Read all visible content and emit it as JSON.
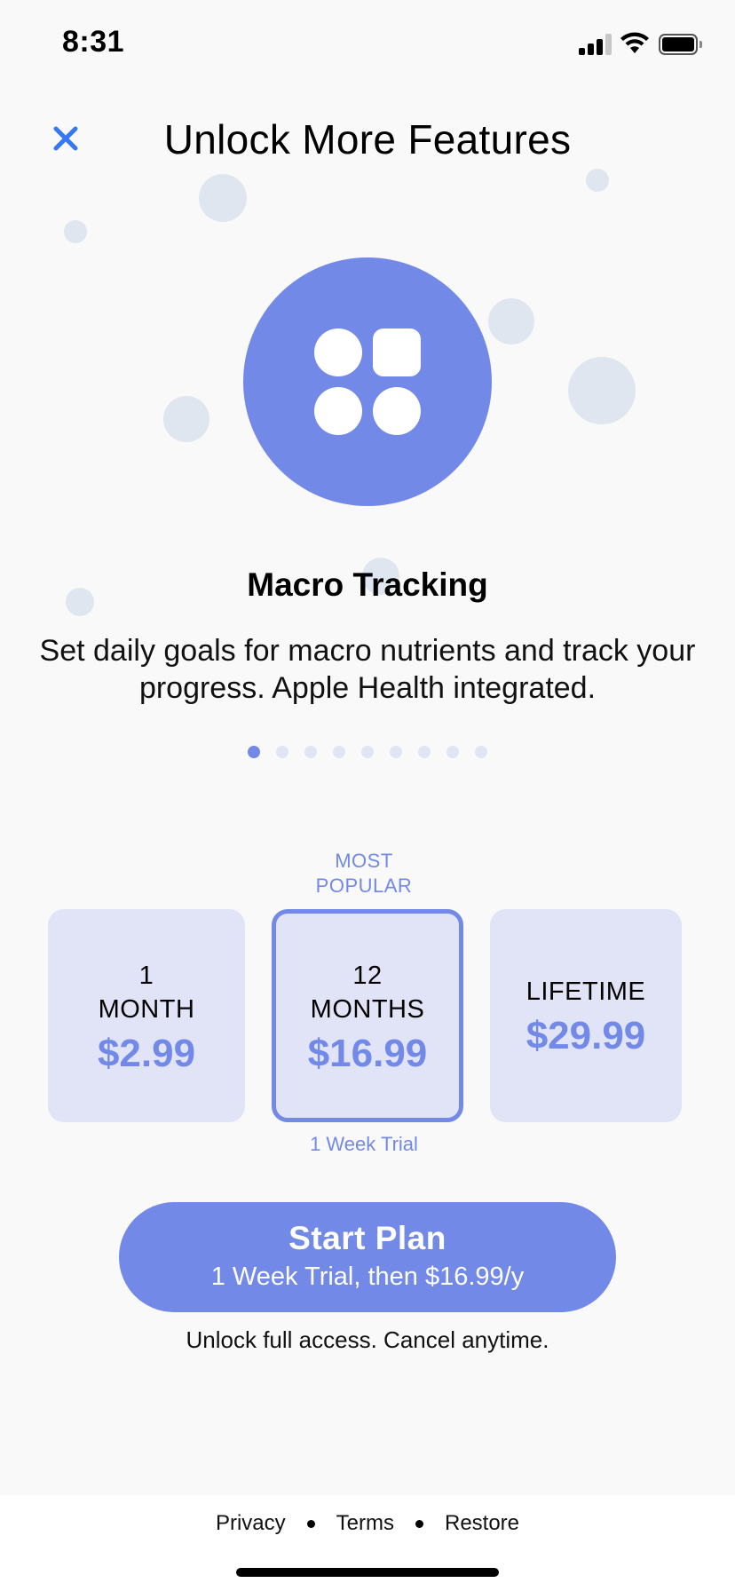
{
  "status_bar": {
    "time": "8:31"
  },
  "header": {
    "title": "Unlock More Features",
    "close_icon": "close-icon"
  },
  "feature": {
    "icon": "apps-grid-icon",
    "title": "Macro Tracking",
    "description": "Set daily goals for macro nutrients and track your progress. Apple Health integrated."
  },
  "pagination": {
    "total": 9,
    "active_index": 0
  },
  "plans": {
    "badge": "MOST\nPOPULAR",
    "items": [
      {
        "name_line1": "1",
        "name_line2": "MONTH",
        "price": "$2.99",
        "selected": false
      },
      {
        "name_line1": "12",
        "name_line2": "MONTHS",
        "price": "$16.99",
        "selected": true
      },
      {
        "name_line1": "LIFETIME",
        "name_line2": "",
        "price": "$29.99",
        "selected": false
      }
    ],
    "trial_note": "1 Week Trial"
  },
  "cta": {
    "label": "Start Plan",
    "sublabel": "1 Week Trial, then $16.99/y"
  },
  "subtext": "Unlock full access. Cancel anytime.",
  "footer": {
    "privacy": "Privacy",
    "terms": "Terms",
    "restore": "Restore"
  },
  "colors": {
    "accent": "#7289e8",
    "card": "#e0e4f6",
    "bubble": "#e0e6ef",
    "close": "#3478f6"
  }
}
